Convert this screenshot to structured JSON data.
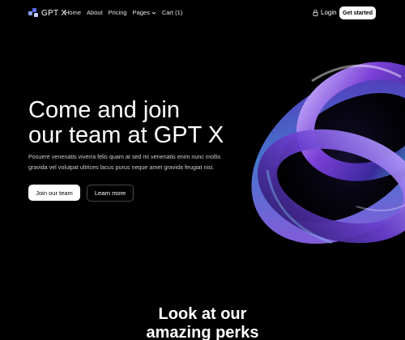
{
  "brand": {
    "name": "GPT X",
    "accent": "#5b6ef0"
  },
  "nav": {
    "items": [
      {
        "label": "Home"
      },
      {
        "label": "About"
      },
      {
        "label": "Pricing"
      },
      {
        "label": "Pages",
        "icon": "chevron-down-icon"
      },
      {
        "label": "Cart (1)"
      }
    ]
  },
  "header": {
    "login_label": "Login",
    "login_icon": "lock-icon",
    "cta_label": "Get started"
  },
  "hero": {
    "title_line1": "Come and join",
    "title_line2": "our team at GPT X",
    "body": "Posuere venenatis viverra felis quam at sed mi venenatis enim nunc mollis gravida vel volutpat ultrices lacus purus neque amet gravida feugiat nisi.",
    "primary_button": "Join our team",
    "secondary_button": "Learn more",
    "art": "iridescent-torus-rings"
  },
  "perks": {
    "title_line1": "Look at our",
    "title_line2": "amazing perks"
  },
  "colors": {
    "background": "#000000",
    "text": "#ffffff",
    "muted_text": "#cfcfcf",
    "ring_purple": "#7b3fd6",
    "ring_blue": "#4a7bd8",
    "ring_teal": "#3fb6c4"
  }
}
